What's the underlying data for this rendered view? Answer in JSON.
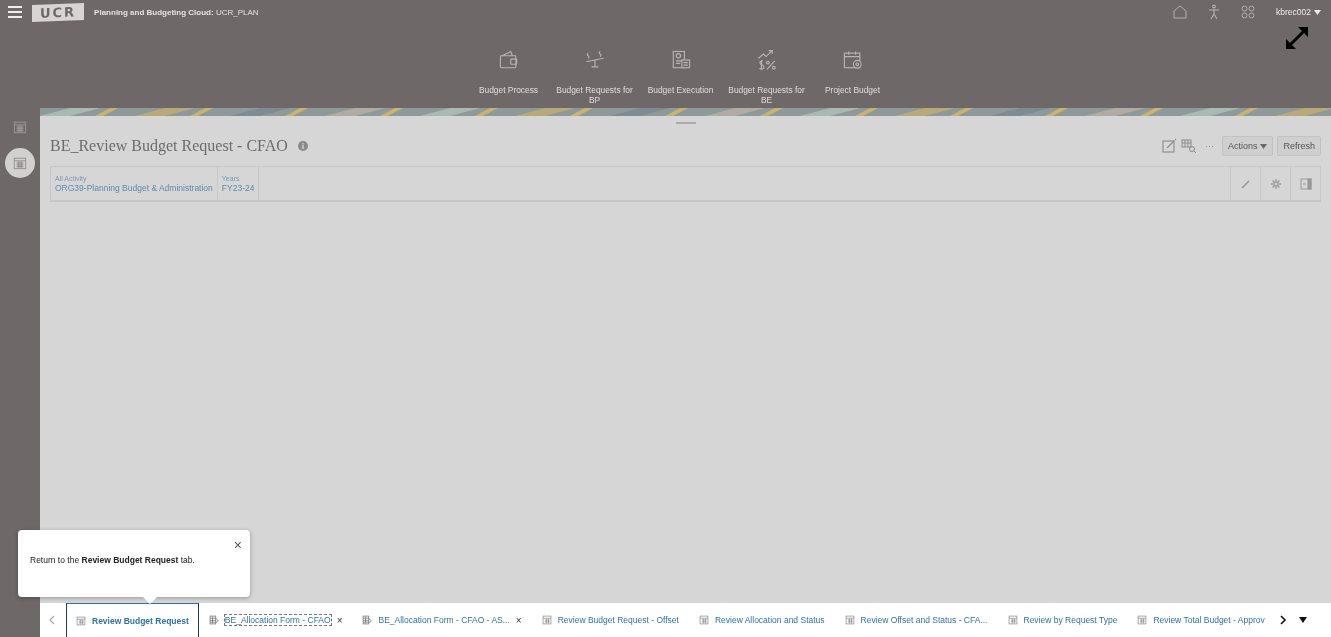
{
  "header": {
    "app_title": "**Planning and Budgeting Cloud:** UCR_PLAN",
    "logo": "UCR",
    "user": "kbrec002"
  },
  "nav_cards": [
    {
      "label": "Budget Process"
    },
    {
      "label": "Budget Requests for BP"
    },
    {
      "label": "Budget Execution"
    },
    {
      "label": "Budget Requests for BE"
    },
    {
      "label": "Project Budget"
    }
  ],
  "sidebar": {
    "items": [
      {
        "selected": false
      },
      {
        "selected": true
      }
    ]
  },
  "form": {
    "title": "BE_Review Budget Request - CFAO",
    "toolbar": {
      "more": "···",
      "actions": "Actions",
      "refresh": "Refresh"
    },
    "pov": [
      {
        "label": "All Activity",
        "value": "ORG39-Planning Budget & Administration"
      },
      {
        "label": "Years",
        "value": "FY23-24"
      }
    ]
  },
  "tooltip": {
    "text": "Return to the **Review Budget Request** tab.",
    "close": "×"
  },
  "tabs": [
    {
      "label": "Review Budget Request",
      "kind": "form",
      "selected": true,
      "focused": false,
      "closable": false
    },
    {
      "label": "BE_Allocation Form - CFAO",
      "kind": "rule",
      "selected": false,
      "focused": true,
      "closable": true
    },
    {
      "label": "BE_Allocation Form - CFAO - AS...",
      "kind": "rule",
      "selected": false,
      "focused": false,
      "closable": true
    },
    {
      "label": "Review Budget Request - Offset",
      "kind": "form",
      "selected": false,
      "focused": false,
      "closable": false
    },
    {
      "label": "Review Allocation and Status",
      "kind": "form",
      "selected": false,
      "focused": false,
      "closable": false
    },
    {
      "label": "Review Offset and Status - CFA...",
      "kind": "form",
      "selected": false,
      "focused": false,
      "closable": false
    },
    {
      "label": "Review by Request Type",
      "kind": "form",
      "selected": false,
      "focused": false,
      "closable": false
    },
    {
      "label": "Review Total Budget - Approv",
      "kind": "form",
      "selected": false,
      "focused": false,
      "closable": false
    }
  ],
  "tab_close": "×"
}
